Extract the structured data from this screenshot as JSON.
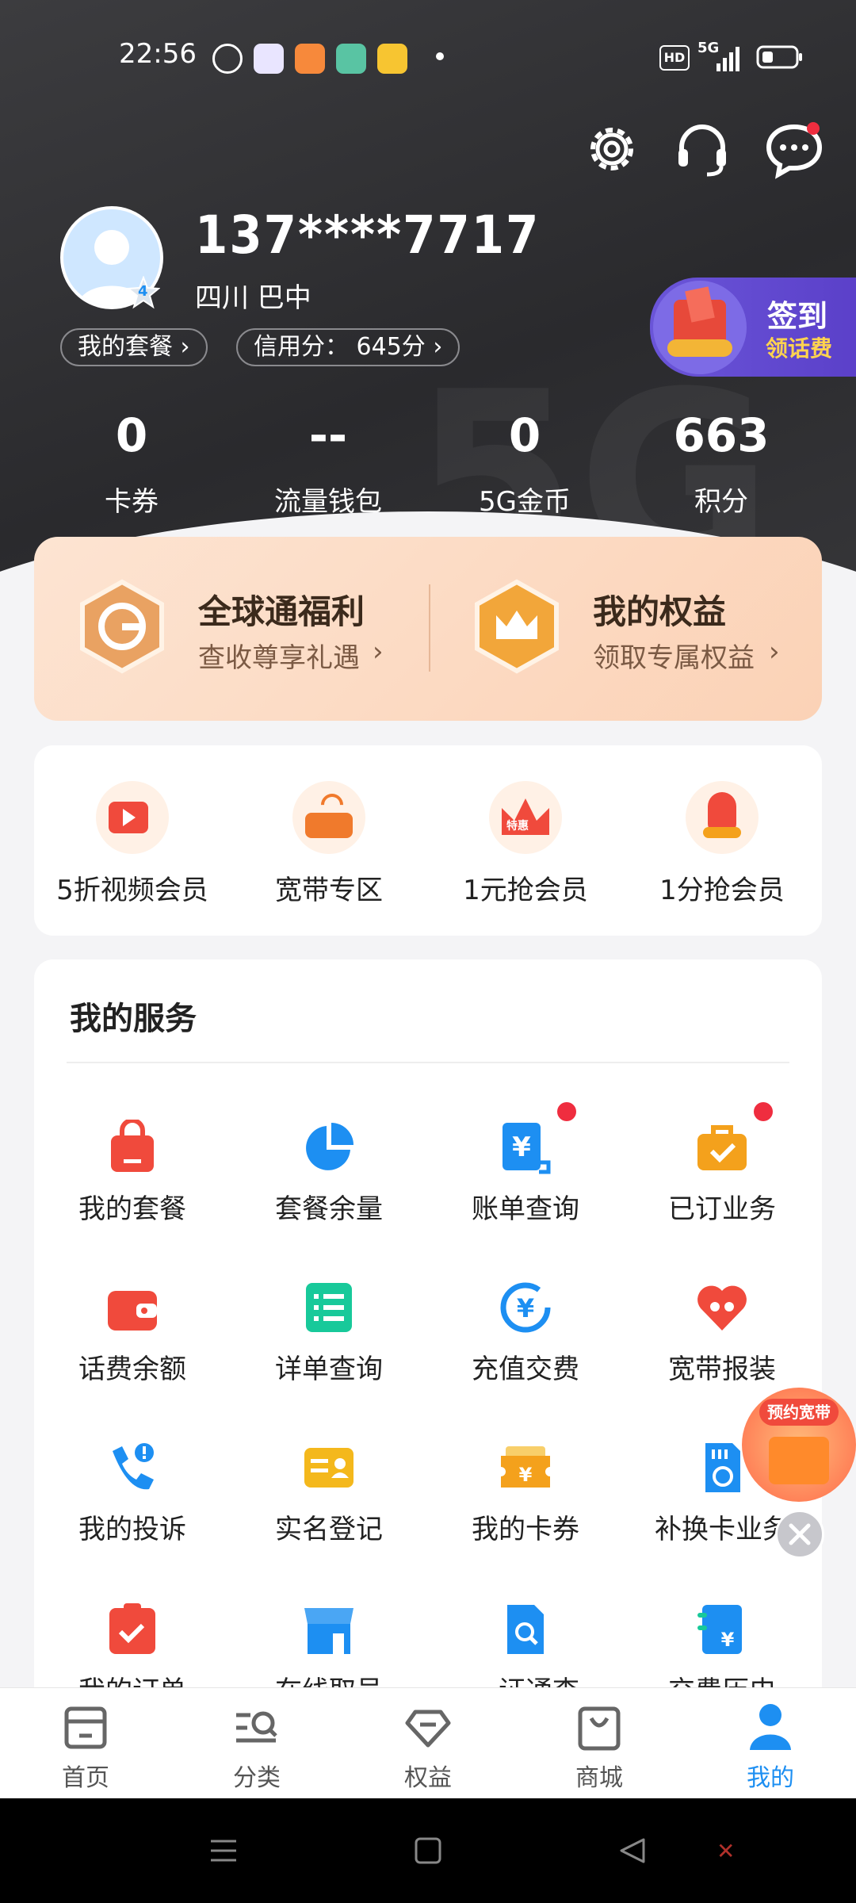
{
  "status_bar": {
    "time": "22:56",
    "network": "5G",
    "hd": "HD"
  },
  "profile": {
    "phone": "137****7717",
    "location": "四川 巴中",
    "level": "4",
    "my_plan": "我的套餐",
    "credit": "信用分： 645分"
  },
  "sign_in": {
    "title": "签到",
    "subtitle": "领话费"
  },
  "stats": [
    {
      "value": "0",
      "label": "卡券"
    },
    {
      "value": "--",
      "label": "流量钱包"
    },
    {
      "value": "0",
      "label": "5G金币"
    },
    {
      "value": "663",
      "label": "积分"
    }
  ],
  "benefits": [
    {
      "title": "全球通福利",
      "subtitle": "查收尊享礼遇"
    },
    {
      "title": "我的权益",
      "subtitle": "领取专属权益"
    }
  ],
  "quick": [
    {
      "label": "5折视频会员"
    },
    {
      "label": "宽带专区"
    },
    {
      "label": "1元抢会员",
      "badge": "特惠"
    },
    {
      "label": "1分抢会员"
    }
  ],
  "services": {
    "title": "我的服务",
    "items": [
      {
        "label": "我的套餐"
      },
      {
        "label": "套餐余量"
      },
      {
        "label": "账单查询",
        "dot": true
      },
      {
        "label": "已订业务",
        "dot": true
      },
      {
        "label": "话费余额"
      },
      {
        "label": "详单查询"
      },
      {
        "label": "充值交费"
      },
      {
        "label": "宽带报装"
      },
      {
        "label": "我的投诉"
      },
      {
        "label": "实名登记"
      },
      {
        "label": "我的卡券"
      },
      {
        "label": "补换卡业务"
      },
      {
        "label": "我的订单"
      },
      {
        "label": "在线取号"
      },
      {
        "label": "一证通查"
      },
      {
        "label": "交费历史"
      }
    ]
  },
  "float_ad": {
    "label": "预约宽带"
  },
  "nav": [
    {
      "label": "首页"
    },
    {
      "label": "分类"
    },
    {
      "label": "权益"
    },
    {
      "label": "商城"
    },
    {
      "label": "我的",
      "active": true
    }
  ],
  "colors": {
    "accent_blue": "#1d8ff2",
    "red": "#f04a3c",
    "orange": "#f4a11c",
    "green": "#18c99a",
    "purple": "#5b40c9"
  }
}
